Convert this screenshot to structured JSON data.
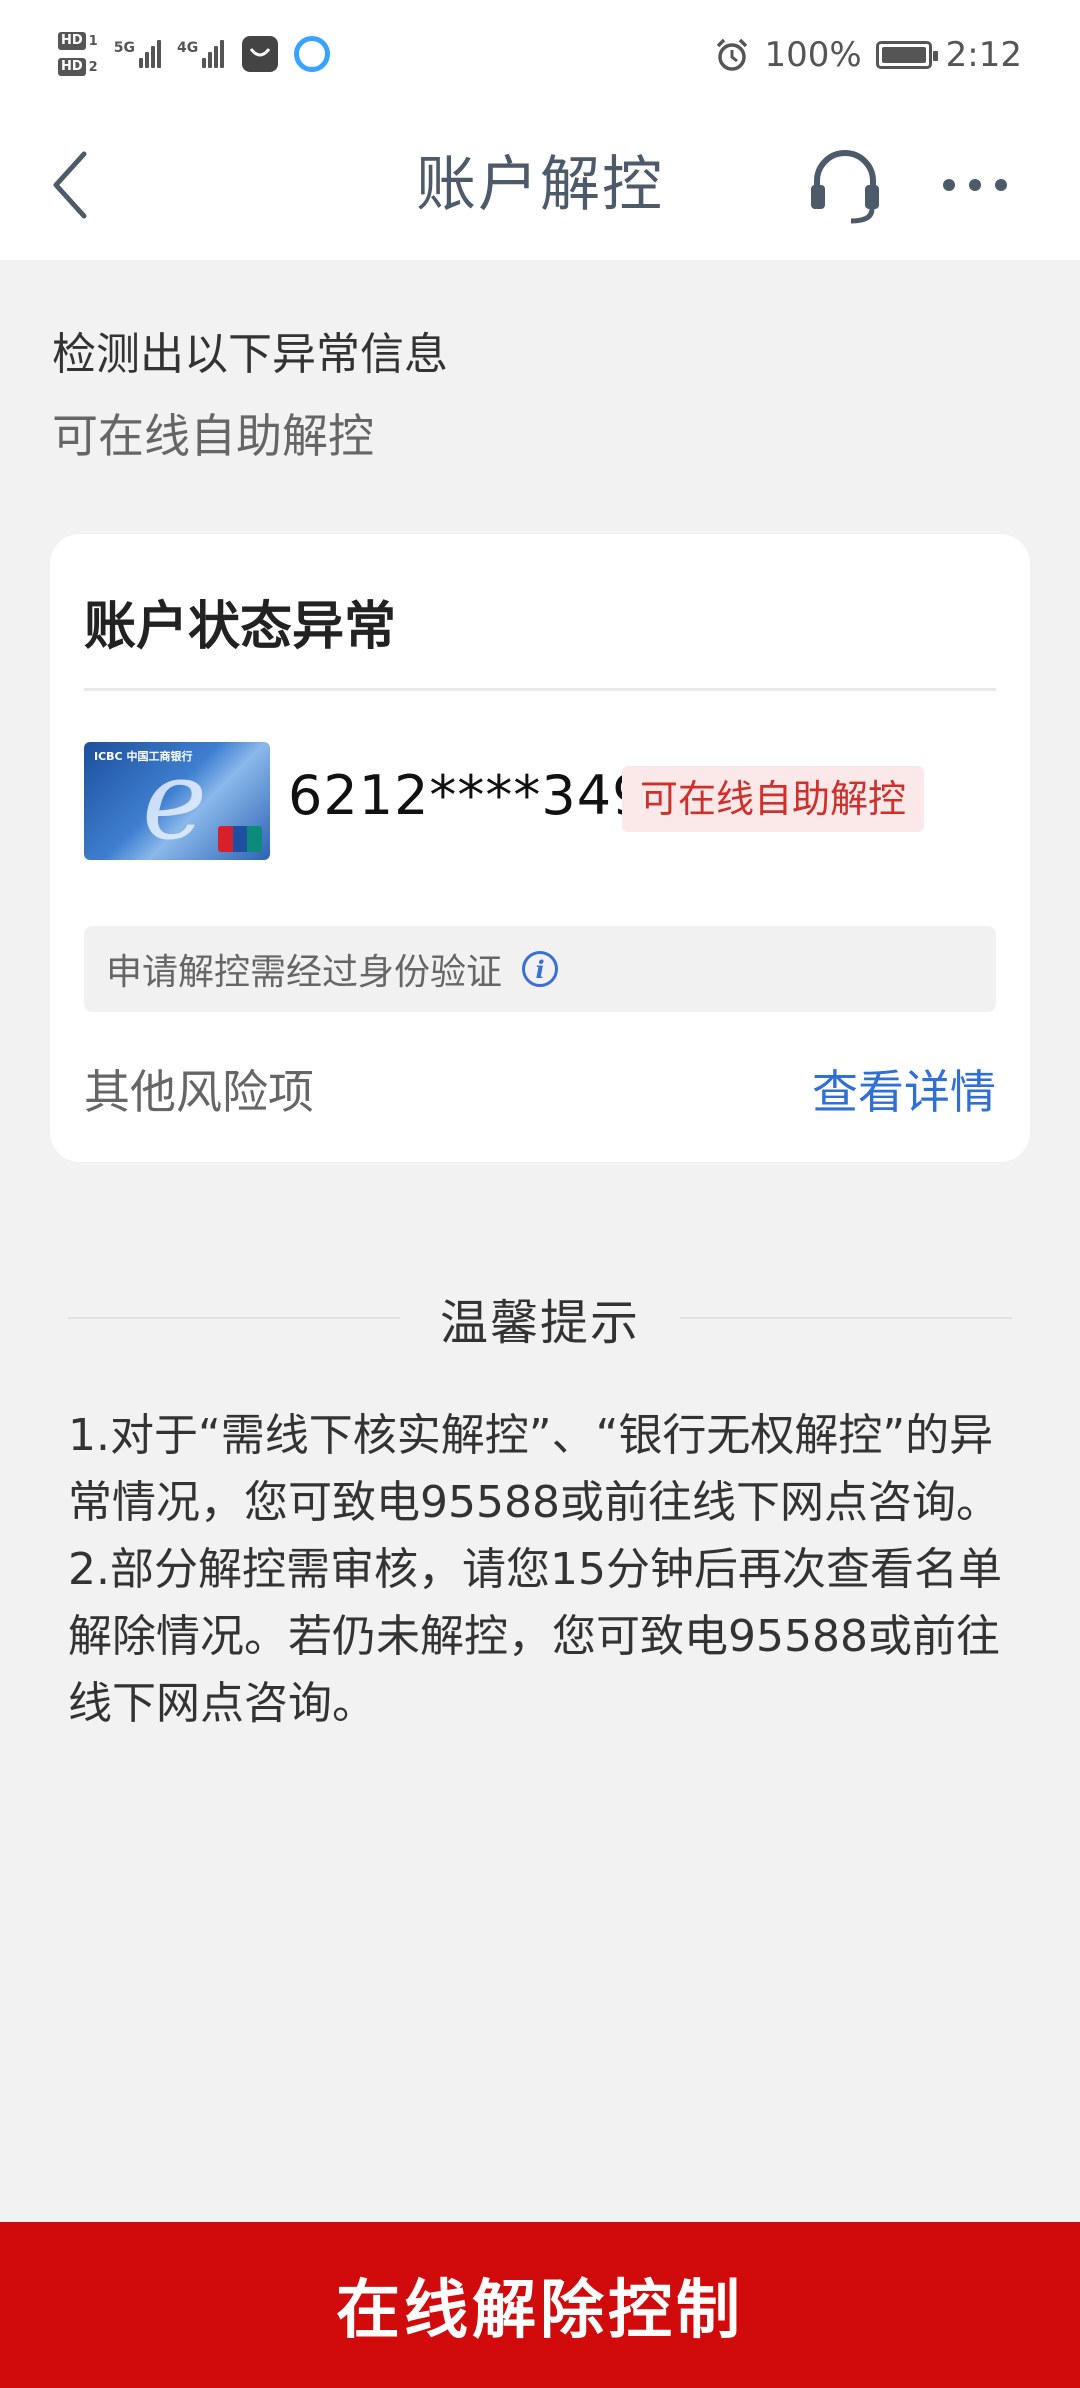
{
  "status_bar": {
    "hd1": "HD",
    "hd1_num": "1",
    "hd2": "HD",
    "hd2_num": "2",
    "net1": "5G",
    "net2": "4G",
    "battery_text": "100%",
    "time": "2:12"
  },
  "nav": {
    "title": "账户解控",
    "back_icon": "chevron-left-icon",
    "service_icon": "headset-icon",
    "more_icon": "more-dots-icon"
  },
  "intro": {
    "line1": "检测出以下异常信息",
    "line2": "可在线自助解控"
  },
  "card": {
    "title": "账户状态异常",
    "bank_card_brand": "ICBC 中国工商银行",
    "card_number": "6212****3499",
    "status_badge": "可在线自助解控",
    "verify_text": "申请解控需经过身份验证",
    "info_icon": "info-icon",
    "other_risk_label": "其他风险项",
    "detail_link": "查看详情"
  },
  "tips": {
    "title": "温馨提示",
    "item1": "1.对于“需线下核实解控”、“银行无权解控”的异常情况，您可致电95588或前往线下网点咨询。",
    "item2": "2.部分解控需审核，请您15分钟后再次查看名单解除情况。若仍未解控，您可致电95588或前往线下网点咨询。"
  },
  "bottom_button": {
    "label": "在线解除控制"
  },
  "colors": {
    "accent_red": "#d10b0b",
    "badge_red": "#d0302b",
    "link_blue": "#2f6fd6"
  }
}
